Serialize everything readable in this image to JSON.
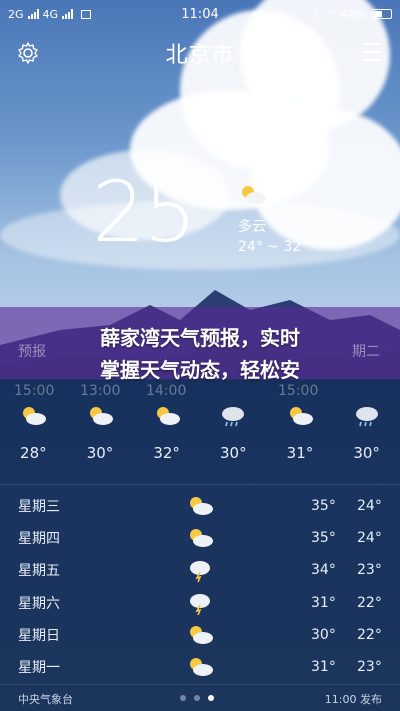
{
  "status_bar": {
    "network_left": "2G",
    "network_right": "4G",
    "time": "11:04",
    "battery": "49%",
    "icons": [
      "signal-icon",
      "signal-icon",
      "image-icon",
      "bluetooth-icon",
      "wifi-icon",
      "battery-icon"
    ]
  },
  "header": {
    "city": "北京市",
    "settings_icon": "gear-icon",
    "menu_icon": "menu-icon"
  },
  "current": {
    "temperature": "25",
    "degree": "°",
    "condition": "多云",
    "range": "24° ~ 32°",
    "icon": "partly-cloudy-icon"
  },
  "banner": {
    "line1": "薛家湾天气预报，实时",
    "line2": "掌握天气动态，轻松安",
    "ghost_left": "预报",
    "ghost_right": "期二",
    "ghost_times": [
      "15:00",
      "13:00",
      "14:00",
      "15:00"
    ]
  },
  "hourly": [
    {
      "icon": "partly-cloudy-icon",
      "temp": "28°"
    },
    {
      "icon": "partly-cloudy-icon",
      "temp": "30°"
    },
    {
      "icon": "partly-cloudy-icon",
      "temp": "32°"
    },
    {
      "icon": "rain-cloud-icon",
      "temp": "30°"
    },
    {
      "icon": "partly-cloudy-icon",
      "temp": "31°"
    },
    {
      "icon": "rain-cloud-icon",
      "temp": "30°"
    }
  ],
  "daily": [
    {
      "day": "星期三",
      "icon": "partly-cloudy-icon",
      "high": "35°",
      "low": "24°"
    },
    {
      "day": "星期四",
      "icon": "partly-cloudy-icon",
      "high": "35°",
      "low": "24°"
    },
    {
      "day": "星期五",
      "icon": "thunder-rain-icon",
      "high": "34°",
      "low": "23°"
    },
    {
      "day": "星期六",
      "icon": "thunder-rain-icon",
      "high": "31°",
      "low": "22°"
    },
    {
      "day": "星期日",
      "icon": "partly-cloudy-icon",
      "high": "30°",
      "low": "22°"
    },
    {
      "day": "星期一",
      "icon": "partly-cloudy-icon",
      "high": "31°",
      "low": "23°"
    }
  ],
  "footer": {
    "source": "中央气象台",
    "published": "11:00 发布",
    "pages": 3,
    "active_page": 3
  }
}
